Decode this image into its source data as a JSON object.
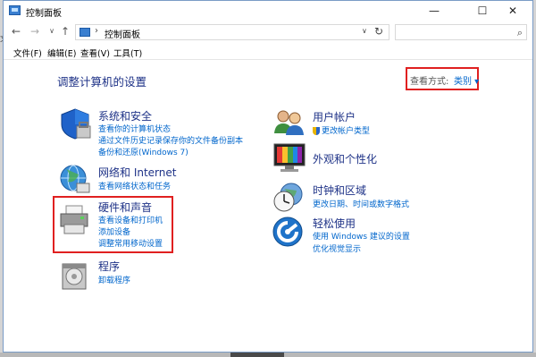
{
  "window": {
    "title": "控制面板"
  },
  "address": {
    "path": "控制面板",
    "search_placeholder": ""
  },
  "menu": [
    "文件(F)",
    "编辑(E)",
    "查看(V)",
    "工具(T)"
  ],
  "heading": "调整计算机的设置",
  "view_by": {
    "label": "查看方式:",
    "value": "类别"
  },
  "left_categories": [
    {
      "title": "系统和安全",
      "links": [
        "查看你的计算机状态",
        "通过文件历史记录保存你的文件备份副本",
        "备份和还原(Windows 7)"
      ]
    },
    {
      "title": "网络和 Internet",
      "links": [
        "查看网络状态和任务"
      ]
    },
    {
      "title": "硬件和声音",
      "links": [
        "查看设备和打印机",
        "添加设备",
        "调整常用移动设置"
      ]
    },
    {
      "title": "程序",
      "links": [
        "卸载程序"
      ]
    }
  ],
  "right_categories": [
    {
      "title": "用户帐户",
      "links": [
        "更改帐户类型"
      ]
    },
    {
      "title": "外观和个性化",
      "links": []
    },
    {
      "title": "时钟和区域",
      "links": [
        "更改日期、时间或数字格式"
      ]
    },
    {
      "title": "轻松使用",
      "links": [
        "使用 Windows 建议的设置",
        "优化视觉显示"
      ]
    }
  ],
  "icons": [
    "control-panel-icon",
    "back-arrow-icon",
    "forward-arrow-icon",
    "up-arrow-icon",
    "refresh-icon",
    "search-icon",
    "shield-icon",
    "network-globe-icon",
    "printer-icon",
    "programs-disc-icon",
    "users-icon",
    "monitor-colors-icon",
    "clock-globe-icon",
    "accessibility-icon"
  ],
  "colors": {
    "link": "#0066cc",
    "heading": "#1e3287",
    "highlight": "#e02020"
  }
}
